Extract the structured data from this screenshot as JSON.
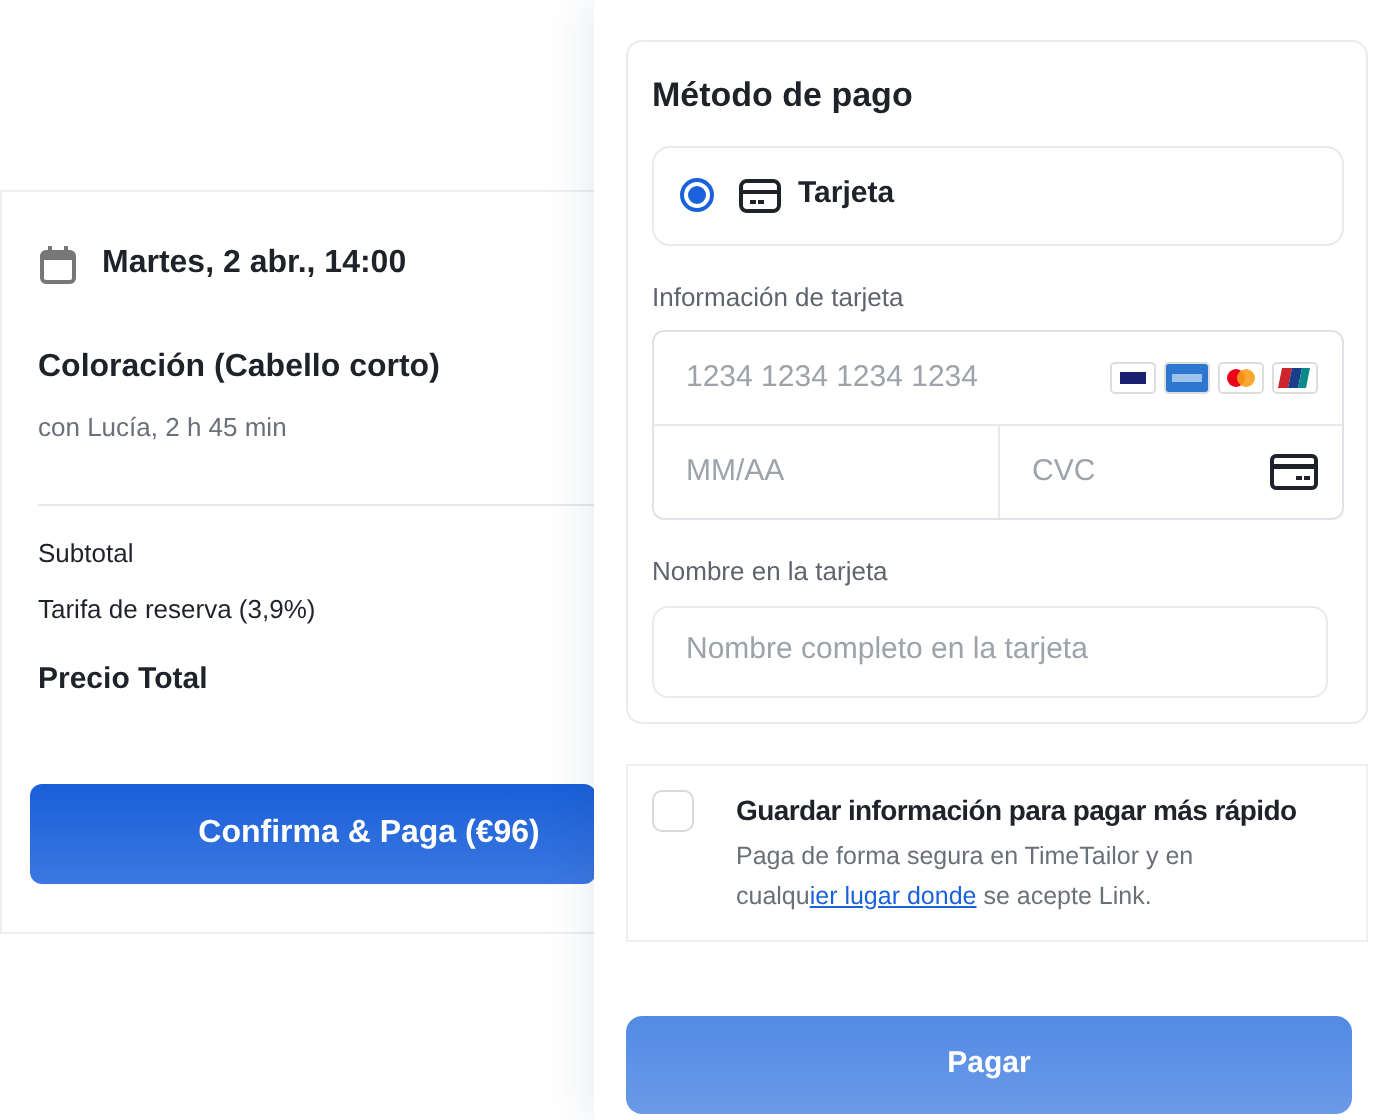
{
  "booking": {
    "datetime": "Martes, 2 abr., 14:00",
    "service": "Coloración (Cabello corto)",
    "details": "con Lucía, 2 h 45 min",
    "summary": [
      {
        "label": "Subtotal",
        "kind": "line"
      },
      {
        "label": "Tarifa de reserva (3,9%)",
        "kind": "line"
      },
      {
        "label": "Precio Total",
        "kind": "total"
      }
    ],
    "button": "Confirma & Paga (€96)"
  },
  "payment": {
    "title": "Método de pago",
    "methods": [
      {
        "label": "Tarjeta",
        "selected": true
      }
    ],
    "card_label": "Información de tarjeta",
    "card_number": {
      "placeholder": "1234 1234 1234 1234"
    },
    "expiry": {
      "placeholder": "MM/AA"
    },
    "cvc": {
      "placeholder": "CVC"
    },
    "name_label": "Nombre en la tarjeta",
    "name": {
      "placeholder": "Nombre completo en la tarjeta"
    }
  },
  "save_info": {
    "checked": false,
    "title": "Guardar información para pagar más rápido",
    "description": {
      "before": "Paga de forma segura en TimeTailor y en cualqu",
      "link": "ier lugar donde",
      "after": " se acepte Link."
    }
  },
  "pay_button": "Pagar"
}
